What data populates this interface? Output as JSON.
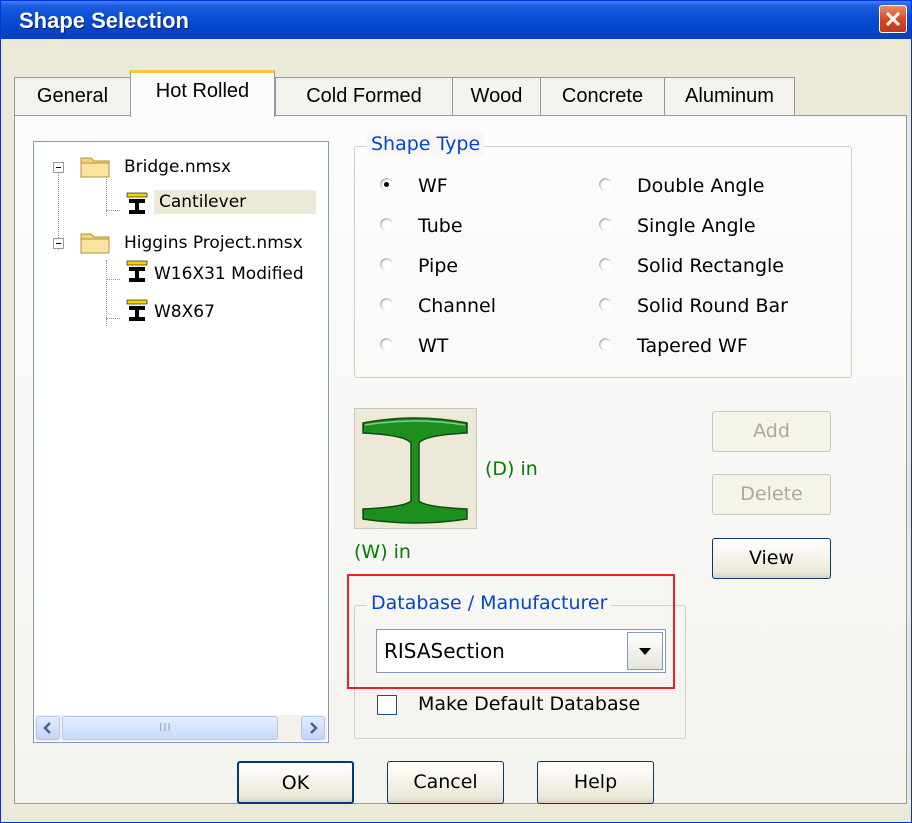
{
  "window": {
    "title": "Shape Selection"
  },
  "tabs": [
    "General",
    "Hot Rolled",
    "Cold Formed",
    "Wood",
    "Concrete",
    "Aluminum"
  ],
  "active_tab": "Hot Rolled",
  "tree": {
    "items": [
      {
        "label": "Bridge.nmsx",
        "type": "folder"
      },
      {
        "label": "Cantilever",
        "type": "shape",
        "selected": true
      },
      {
        "label": "Higgins Project.nmsx",
        "type": "folder"
      },
      {
        "label": "W16X31 Modified",
        "type": "shape"
      },
      {
        "label": "W8X67",
        "type": "shape"
      }
    ],
    "scroll_grip": "III"
  },
  "shape_type": {
    "legend": "Shape Type",
    "options": [
      "WF",
      "Tube",
      "Pipe",
      "Channel",
      "WT",
      "Double Angle",
      "Single Angle",
      "Solid Rectangle",
      "Solid Round Bar",
      "Tapered WF"
    ],
    "selected": "WF"
  },
  "preview": {
    "depth_label": "(D) in",
    "width_label": "(W) in",
    "shape_color": "#1e8f1e"
  },
  "side_buttons": {
    "add": "Add",
    "delete": "Delete",
    "view": "View"
  },
  "database": {
    "legend": "Database / Manufacturer",
    "value": "RISASection",
    "default_label": "Make Default Database",
    "default_checked": false
  },
  "footer": {
    "ok": "OK",
    "cancel": "Cancel",
    "help": "Help"
  }
}
